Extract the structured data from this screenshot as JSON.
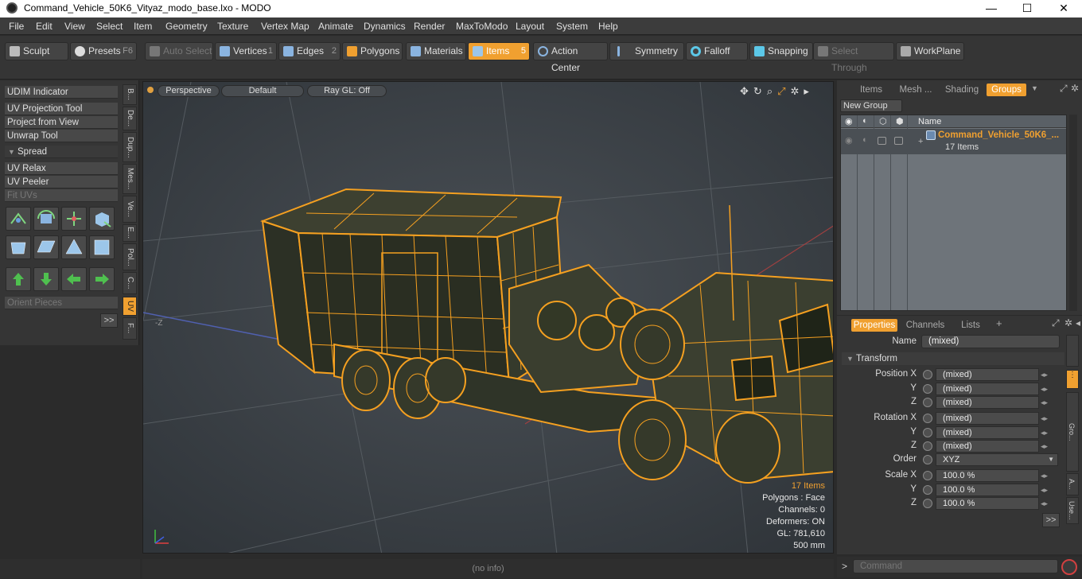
{
  "window": {
    "title": "Command_Vehicle_50K6_Vityaz_modo_base.lxo - MODO",
    "minimize": "—",
    "maximize": "☐",
    "close": "✕"
  },
  "menu": [
    "File",
    "Edit",
    "View",
    "Select",
    "Item",
    "Geometry",
    "Texture",
    "Vertex Map",
    "Animate",
    "Dynamics",
    "Render",
    "MaxToModo",
    "Layout",
    "System",
    "Help"
  ],
  "toolbar": {
    "sculpt": "Sculpt",
    "presets": "Presets",
    "presets_key": "F6",
    "auto_select": "Auto Select",
    "vertices": "Vertices",
    "vertices_key": "1",
    "edges": "Edges",
    "edges_key": "2",
    "polygons": "Polygons",
    "materials": "Materials",
    "items": "Items",
    "items_key": "5",
    "action_center": "Action Center",
    "symmetry": "Symmetry",
    "falloff": "Falloff",
    "snapping": "Snapping",
    "select_through": "Select Through",
    "workplane": "WorkPlane"
  },
  "left_panel": {
    "udim": "UDIM Indicator",
    "uv_projection": "UV Projection Tool",
    "project_from_view": "Project from View",
    "unwrap": "Unwrap Tool",
    "spread": "Spread",
    "uv_relax": "UV Relax",
    "uv_peeler": "UV Peeler",
    "fit_uvs": "Fit UVs",
    "orient_pieces": "Orient Pieces",
    "more": ">>",
    "vtabs": [
      "B...",
      "De...",
      "Dup...",
      "Mes...",
      "Ve...",
      "E...",
      "Pol...",
      "C...",
      "UV",
      "F..."
    ]
  },
  "viewport": {
    "perspective": "Perspective",
    "default": "Default",
    "raygl": "Ray GL: Off",
    "axis_label": "-Z",
    "info": {
      "items": "17 Items",
      "polygons": "Polygons : Face",
      "channels": "Channels: 0",
      "deformers": "Deformers: ON",
      "gl": "GL: 781,610",
      "scale": "500 mm"
    }
  },
  "status": "(no info)",
  "groups_panel": {
    "tabs": [
      "Items",
      "Mesh ...",
      "Shading",
      "Groups"
    ],
    "new_group": "New Group",
    "name_col": "Name",
    "group_name": "Command_Vehicle_50K6_...",
    "group_count": "17 Items"
  },
  "properties": {
    "tabs": [
      "Properties",
      "Channels",
      "Lists"
    ],
    "name_label": "Name",
    "name_value": "(mixed)",
    "transform": "Transform",
    "position_label": "Position X",
    "rotation_label": "Rotation X",
    "order_label": "Order",
    "order_value": "XYZ",
    "scale_label": "Scale X",
    "y": "Y",
    "z": "Z",
    "mixed": "(mixed)",
    "scale_value": "100.0 %",
    "more": ">>",
    "side_tabs": [
      "Gro...",
      "A...",
      "Use..."
    ]
  },
  "command": {
    "prompt": ">",
    "placeholder": "Command"
  },
  "colors": {
    "accent": "#f0a030",
    "wire": "#f5a020"
  }
}
